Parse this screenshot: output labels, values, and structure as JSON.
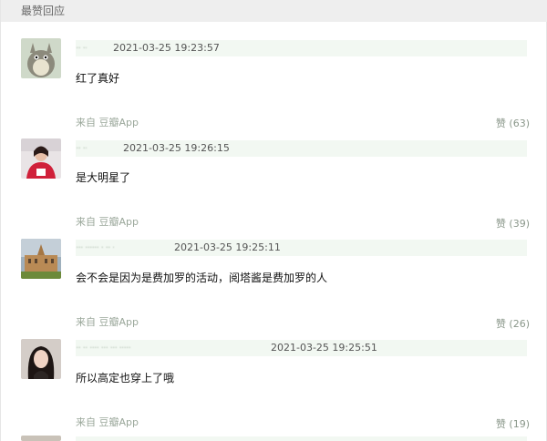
{
  "section": {
    "title": "最赞回应"
  },
  "comments": [
    {
      "user": "·· ··",
      "timestamp": "2021-03-25 19:23:57",
      "text": "红了真好",
      "source": "来自 豆瓣App",
      "votes": "赞 (63)",
      "avatar": "totoro-avatar"
    },
    {
      "user": "·· ··",
      "timestamp": "2021-03-25 19:26:15",
      "text": "是大明星了",
      "source": "来自 豆瓣App",
      "votes": "赞 (39)",
      "avatar": "woman-red-avatar"
    },
    {
      "user": "··· ······ · ·· ·",
      "timestamp": "2021-03-25 19:25:11",
      "text": "会不会是因为是费加罗的活动，阅塔酱是费加罗的人",
      "source": "来自 豆瓣App",
      "votes": "赞 (26)",
      "avatar": "building-avatar"
    },
    {
      "user": "·· ·· ···· ··· ··· ·····",
      "timestamp": "2021-03-25 19:25:51",
      "text": "所以高定也穿上了哦",
      "source": "来自 豆瓣App",
      "votes": "赞 (19)",
      "avatar": "woman-portrait-avatar"
    }
  ]
}
